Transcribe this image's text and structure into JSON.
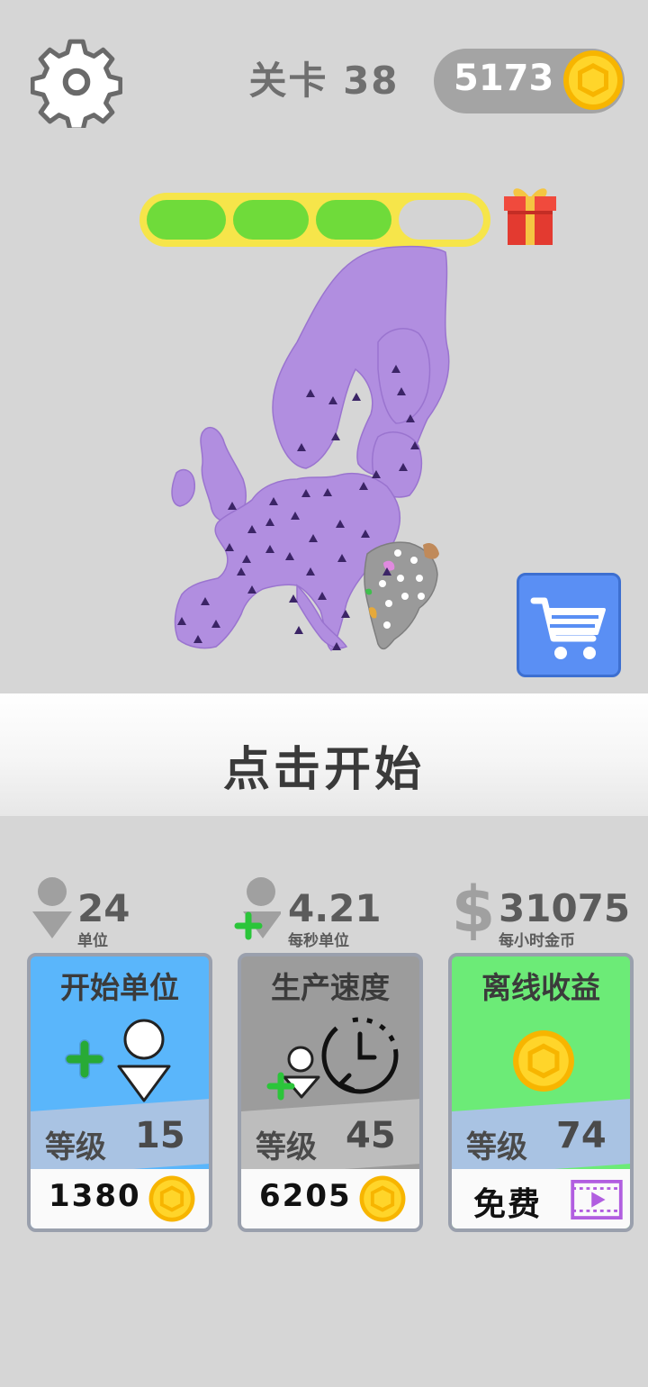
{
  "header": {
    "level_label": "关卡 38",
    "coins": "5173"
  },
  "progress": {
    "filled_segments": 3,
    "total_segments": 4,
    "fill_color": "#6fdb3a",
    "empty_color": "#d4d4d4"
  },
  "map": {
    "description_icon": "europe-map",
    "player_color": "#b18ee0",
    "enemy_color": "#9a9a9a"
  },
  "tap_to_start": "点击开始",
  "stats": [
    {
      "value": "24",
      "label": "单位",
      "icon": "unit-icon"
    },
    {
      "value": "4.21",
      "label": "每秒单位",
      "icon": "unit-plus-icon"
    },
    {
      "value": "31075",
      "label": "每小时金币",
      "icon": "dollar-icon"
    }
  ],
  "cards": [
    {
      "title": "开始单位",
      "level_label": "等级",
      "level": "15",
      "price": "1380",
      "color": "#5ab6fb",
      "icon": "add-unit-icon"
    },
    {
      "title": "生产速度",
      "level_label": "等级",
      "level": "45",
      "price": "6205",
      "color": "#9c9c9c",
      "icon": "clock-icon"
    },
    {
      "title": "离线收益",
      "level_label": "等级",
      "level": "74",
      "price": "免费",
      "color": "#6ceb77",
      "icon": "coin-icon"
    }
  ]
}
